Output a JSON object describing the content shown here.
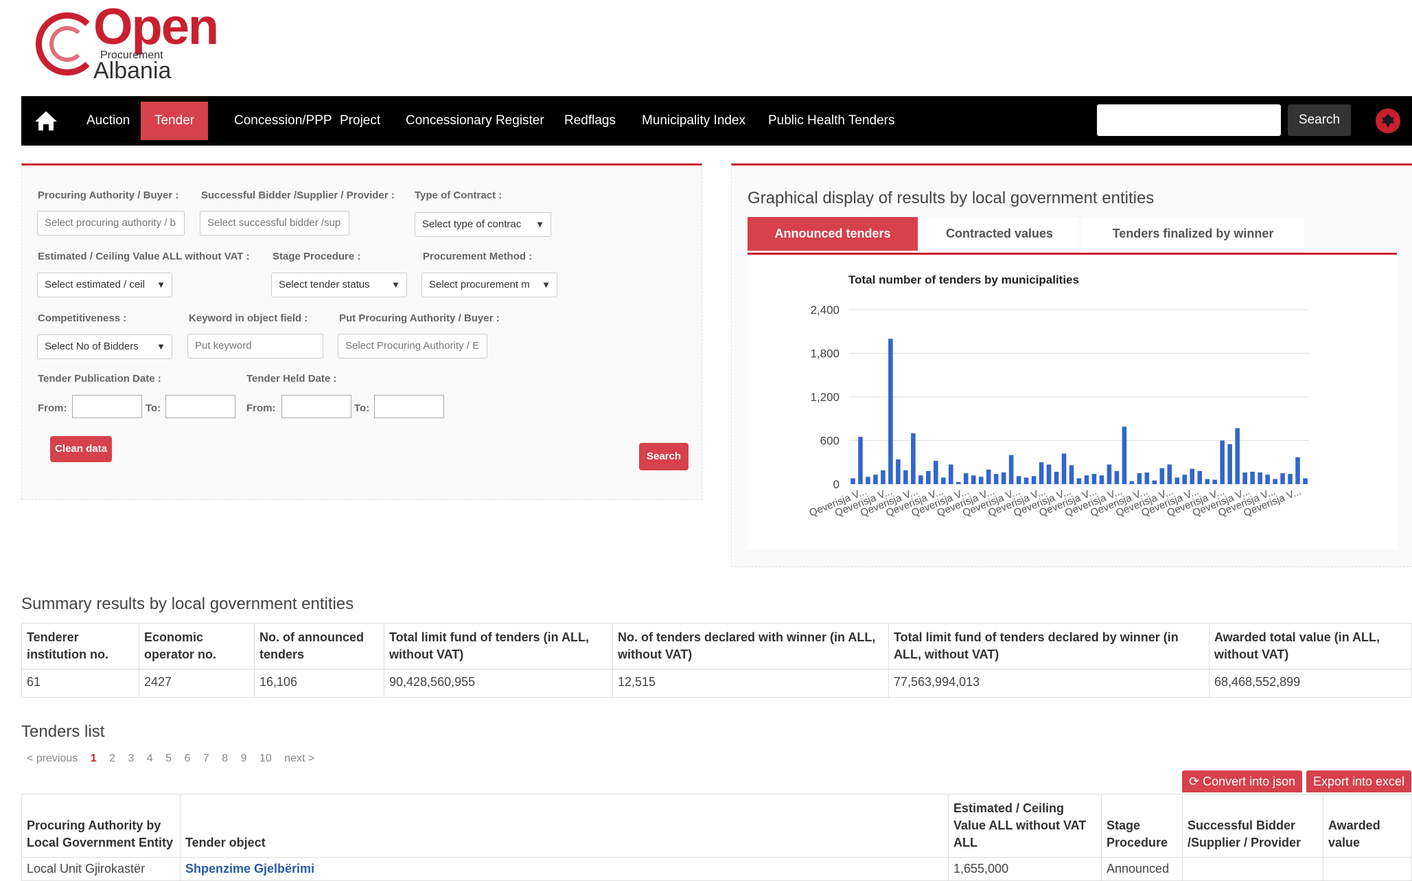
{
  "logo": {
    "open": "Open",
    "procurement": "Procurement",
    "albania": "Albania"
  },
  "nav": {
    "items": [
      "Auction",
      "Tender",
      "Concession/PPP",
      "Project",
      "Concessionary Register",
      "Redflags",
      "Municipality Index",
      "Public Health Tenders"
    ],
    "active": "Tender",
    "search_placeholder": "",
    "search_label": "Search"
  },
  "filters": {
    "procuring_authority_label": "Procuring Authority / Buyer :",
    "procuring_authority_placeholder": "Select procuring authority / b",
    "bidder_label": "Successful Bidder /Supplier / Provider :",
    "bidder_placeholder": "Select successful bidder /sup",
    "contract_type_label": "Type of Contract :",
    "contract_type_value": "Select type of contrac",
    "estimated_label": "Estimated / Ceiling Value ALL without VAT :",
    "estimated_value": "Select estimated / ceil",
    "stage_label": "Stage Procedure :",
    "stage_value": "Select tender status",
    "method_label": "Procurement Method :",
    "method_value": "Select procurement m",
    "competitiveness_label": "Competitiveness :",
    "competitiveness_value": "Select No of Bidders",
    "keyword_label": "Keyword in object field :",
    "keyword_placeholder": "Put  keyword",
    "put_authority_label": "Put Procuring Authority / Buyer :",
    "put_authority_placeholder": "Select Procuring Authority / E",
    "publication_date_label": "Tender Publication Date :",
    "held_date_label": "Tender Held Date :",
    "from_label": "From:",
    "to_label": "To:",
    "clean_label": "Clean data",
    "search_label": "Search"
  },
  "chart_panel": {
    "heading": "Graphical display of results by local government entities",
    "tabs": [
      "Announced tenders",
      "Contracted values",
      "Tenders finalized by winner"
    ],
    "active_tab": "Announced tenders"
  },
  "chart_data": {
    "type": "bar",
    "title": "Total number of tenders by municipalities",
    "xlabel": "",
    "ylabel": "",
    "ylim": [
      0,
      2400
    ],
    "yticks": [
      0,
      600,
      1200,
      1800,
      2400
    ],
    "grid": true,
    "legend": "none",
    "color": "#3366cc",
    "tick_label": "Qeverisja V...",
    "tick_label_count": 18,
    "values": [
      80,
      650,
      100,
      130,
      190,
      2000,
      340,
      190,
      700,
      120,
      180,
      320,
      90,
      270,
      30,
      150,
      120,
      100,
      200,
      140,
      160,
      400,
      110,
      90,
      110,
      300,
      270,
      170,
      420,
      260,
      80,
      120,
      140,
      120,
      270,
      180,
      790,
      40,
      150,
      160,
      50,
      220,
      270,
      90,
      130,
      210,
      180,
      70,
      60,
      600,
      550,
      770,
      160,
      170,
      160,
      130,
      70,
      150,
      140,
      370,
      80
    ]
  },
  "summary": {
    "title": "Summary results by local government entities",
    "headers": [
      "Tenderer institution no.",
      "Economic operator no.",
      "No. of announced tenders",
      "Total limit fund of tenders (in ALL, without VAT)",
      "No. of tenders declared with winner (in ALL, without VAT)",
      "Total limit fund of tenders declared by winner (in ALL, without VAT)",
      "Awarded total value (in ALL, without VAT)"
    ],
    "row": [
      "61",
      "2427",
      "16,106",
      "90,428,560,955",
      "12,515",
      "77,563,994,013",
      "68,468,552,899"
    ]
  },
  "tenders": {
    "title": "Tenders list",
    "pagination": {
      "prev": "< previous",
      "pages": [
        "1",
        "2",
        "3",
        "4",
        "5",
        "6",
        "7",
        "8",
        "9",
        "10"
      ],
      "current": "1",
      "next": "next >"
    },
    "convert_json_label": "Convert into json",
    "export_excel_label": "Export into excel",
    "headers": [
      "Procuring Authority by Local Government Entity",
      "Tender object",
      "Estimated / Ceiling Value ALL without VAT ALL",
      "Stage Procedure",
      "Successful Bidder /Supplier / Provider",
      "Awarded value"
    ],
    "rows": [
      [
        "Local Unit Gjirokastër",
        "Shpenzime Gjelbërimi",
        "1,655,000",
        "Announced",
        "",
        ""
      ]
    ]
  },
  "colors": {
    "brand_red": "#c9202f",
    "button_red": "#d6414b",
    "nav_bg": "#000000",
    "bar_blue": "#3366cc"
  }
}
